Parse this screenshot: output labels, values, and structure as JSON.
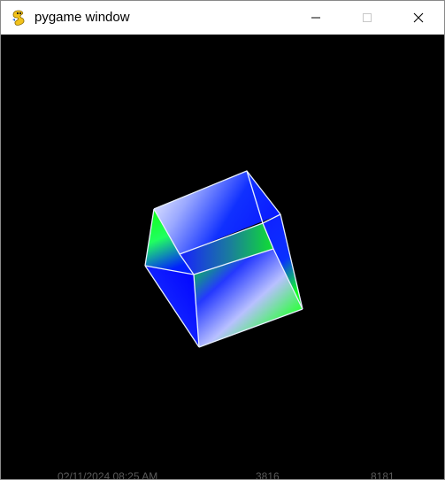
{
  "window": {
    "title": "pygame window",
    "app_icon": "pygame-snake-icon",
    "controls": {
      "minimize_icon": "minimize-icon",
      "maximize_icon": "maximize-icon",
      "close_icon": "close-icon"
    }
  },
  "canvas": {
    "background": "#000000",
    "scene": "rotating-gradient-cube",
    "edge_color": "#e8f0ff",
    "face_colors": [
      "#00ff00",
      "#0000ff",
      "#ffffff"
    ]
  },
  "background_bleed": {
    "texts": [
      "0?/11/2024  08:25 AM",
      "3816",
      "8181"
    ]
  }
}
